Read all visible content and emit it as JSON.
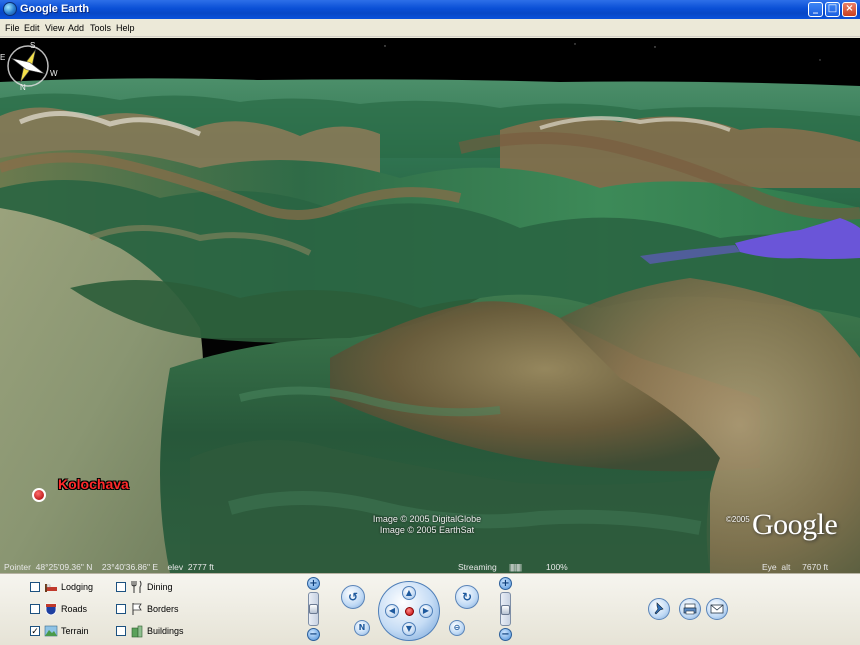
{
  "window": {
    "title": "Google Earth",
    "controls": {
      "minimize": "_",
      "maximize": "□",
      "close": "×"
    }
  },
  "menu": [
    "File",
    "Edit",
    "View",
    "Add",
    "Tools",
    "Help"
  ],
  "map": {
    "place_label": "Kolochava",
    "compass_letters": {
      "north": "N",
      "east": "E",
      "south": "S",
      "west": "W"
    },
    "credits": [
      "Image © 2005 DigitalGlobe",
      "Image © 2005 EarthSat"
    ],
    "copyright": "©2005",
    "logo": "Google",
    "lake_color": "#6a55d8",
    "sky_color": "#000000"
  },
  "status": {
    "pointer": "Pointer  48°25'09.36\" N    23°40'36.86\" E    elev  2777 ft",
    "streaming_label": "Streaming",
    "streaming_bar": "||||||||||",
    "streaming_percent": "100%",
    "streaming_progress": 1.0,
    "eye_alt": "Eye  alt     7670 ft"
  },
  "layers": [
    {
      "label": "Lodging",
      "checked": false,
      "icon": "bed-icon"
    },
    {
      "label": "Dining",
      "checked": false,
      "icon": "fork-knife-icon"
    },
    {
      "label": "Roads",
      "checked": false,
      "icon": "road-shield-icon"
    },
    {
      "label": "Borders",
      "checked": false,
      "icon": "flag-icon"
    },
    {
      "label": "Terrain",
      "checked": true,
      "icon": "terrain-icon"
    },
    {
      "label": "Buildings",
      "checked": false,
      "icon": "building-icon"
    }
  ],
  "navigation": {
    "zoom_in": "+",
    "zoom_out": "−",
    "tilt_up": "+",
    "tilt_down": "−",
    "arrow_up": "▲",
    "arrow_down": "▼",
    "arrow_left": "◀",
    "arrow_right": "▶",
    "north_button": "N",
    "rotate_left": "↺",
    "rotate_right": "↻",
    "reset_tilt": "⊖"
  },
  "actions": {
    "placemark_icon": "pushpin-icon",
    "print_icon": "printer-icon",
    "email_icon": "envelope-icon"
  },
  "colors": {
    "titlebar": "#0a4fd6",
    "panel": "#ece9d8",
    "label_red": "#ff2a2a"
  }
}
